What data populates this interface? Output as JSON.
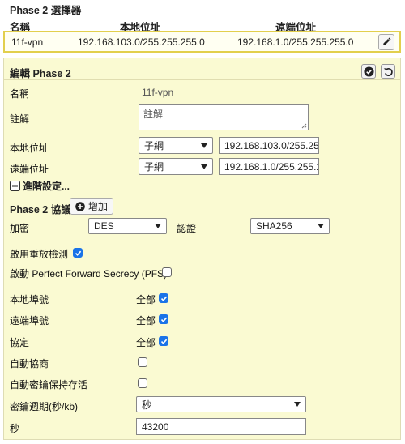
{
  "selector": {
    "title": "Phase 2 選擇器",
    "headers": {
      "name": "名稱",
      "local": "本地位址",
      "remote": "遠端位址"
    },
    "row": {
      "name": "11f-vpn",
      "local": "192.168.103.0/255.255.255.0",
      "remote": "192.168.1.0/255.255.255.0"
    }
  },
  "editor": {
    "title": "編輯 Phase 2",
    "name_label": "名稱",
    "name_value": "11f-vpn",
    "comment_label": "註解",
    "comment_placeholder": "註解",
    "local_label": "本地位址",
    "local_type": "子網",
    "local_value": "192.168.103.0/255.255.",
    "remote_label": "遠端位址",
    "remote_type": "子網",
    "remote_value": "192.168.1.0/255.255.25",
    "advanced_label": "進階設定..."
  },
  "proposal": {
    "title": "Phase 2 協議",
    "add_label": "增加",
    "encryption_label": "加密",
    "encryption_value": "DES",
    "auth_label": "認證",
    "auth_value": "SHA256"
  },
  "options": {
    "replay_label": "啟用重放檢測",
    "replay_checked": true,
    "pfs_label": "啟動 Perfect Forward Secrecy (PFS)",
    "pfs_checked": false,
    "local_port_label": "本地埠號",
    "local_port_all": "全部",
    "remote_port_label": "遠端埠號",
    "remote_port_all": "全部",
    "protocol_label": "協定",
    "protocol_all": "全部",
    "auto_negotiate_label": "自動協商",
    "auto_negotiate_checked": false,
    "keepalive_label": "自動密鑰保持存活",
    "keepalive_checked": false,
    "key_lifetime_label": "密鑰週期(秒/kb)",
    "key_lifetime_unit": "秒",
    "seconds_label": "秒",
    "seconds_value": "43200"
  },
  "colors": {
    "panel_bg": "#fafad2",
    "highlight_border": "#e2cf4d",
    "checkbox_blue": "#1a73e8"
  }
}
